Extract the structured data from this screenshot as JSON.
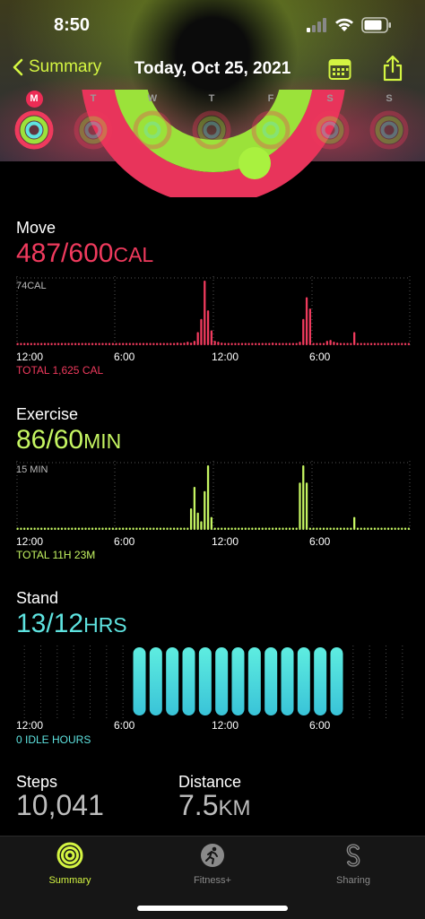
{
  "status": {
    "time": "8:50"
  },
  "nav": {
    "back_label": "Summary",
    "title": "Today, Oct 25, 2021"
  },
  "week": [
    {
      "letter": "M",
      "today": true
    },
    {
      "letter": "T",
      "today": false
    },
    {
      "letter": "W",
      "today": false
    },
    {
      "letter": "T",
      "today": false
    },
    {
      "letter": "F",
      "today": false
    },
    {
      "letter": "S",
      "today": false
    },
    {
      "letter": "S",
      "today": false
    }
  ],
  "colors": {
    "move": "#ef3a5d",
    "exercise": "#c5f562",
    "stand": "#5ee3e0",
    "accent": "#d4f542"
  },
  "move": {
    "label": "Move",
    "value": "487/600",
    "unit": "CAL",
    "max_label": "74CAL",
    "total": "TOTAL 1,625 CAL",
    "axis": [
      "12:00",
      "6:00",
      "12:00",
      "6:00"
    ]
  },
  "exercise": {
    "label": "Exercise",
    "value": "86/60",
    "unit": "MIN",
    "max_label": "15 MIN",
    "total": "TOTAL 11H 23M",
    "axis": [
      "12:00",
      "6:00",
      "12:00",
      "6:00"
    ]
  },
  "stand": {
    "label": "Stand",
    "value": "13/12",
    "unit": "HRS",
    "total": "0 IDLE HOURS",
    "axis": [
      "12:00",
      "6:00",
      "12:00",
      "6:00"
    ]
  },
  "steps": {
    "label": "Steps",
    "value": "10,041"
  },
  "distance": {
    "label": "Distance",
    "value": "7.5",
    "unit": "KM"
  },
  "tabs": [
    {
      "label": "Summary",
      "icon": "activity-rings-icon",
      "active": true
    },
    {
      "label": "Fitness+",
      "icon": "running-figure-icon",
      "active": false
    },
    {
      "label": "Sharing",
      "icon": "sharing-icon",
      "active": false
    }
  ],
  "chart_data": [
    {
      "type": "bar",
      "title": "Move",
      "ylabel": "74CAL",
      "x": [
        "12:00",
        "6:00",
        "12:00",
        "6:00"
      ],
      "values": [
        1,
        1,
        1,
        1,
        1,
        1,
        1,
        1,
        1,
        1,
        1,
        1,
        1,
        1,
        1,
        1,
        1,
        1,
        1,
        1,
        1,
        1,
        1,
        1,
        1,
        1,
        1,
        1,
        1,
        1,
        1,
        1,
        1,
        1,
        1,
        1,
        1,
        1,
        1,
        1,
        1,
        1,
        1,
        2,
        1,
        1,
        2,
        3,
        2,
        3,
        4,
        3,
        5,
        15,
        30,
        74,
        40,
        17,
        5,
        4,
        3,
        2,
        2,
        2,
        2,
        1,
        1,
        1,
        1,
        1,
        1,
        1,
        1,
        2,
        2,
        3,
        2,
        1,
        1,
        1,
        1,
        2,
        2,
        4,
        30,
        55,
        42,
        2,
        1,
        1,
        2,
        5,
        6,
        4,
        3,
        2,
        2,
        2,
        2,
        15,
        2,
        1,
        1,
        1,
        1,
        1,
        1,
        1,
        1,
        1,
        1,
        1,
        1,
        1,
        1,
        1
      ],
      "ylim": [
        0,
        74
      ]
    },
    {
      "type": "bar",
      "title": "Exercise",
      "ylabel": "15 MIN",
      "x": [
        "12:00",
        "6:00",
        "12:00",
        "6:00"
      ],
      "values": [
        0,
        0,
        0,
        0,
        0,
        0,
        0,
        0,
        0,
        0,
        0,
        0,
        0,
        0,
        0,
        0,
        0,
        0,
        0,
        0,
        0,
        0,
        0,
        0,
        0,
        0,
        0,
        0,
        0,
        0,
        0,
        0,
        0,
        0,
        0,
        0,
        0,
        0,
        0,
        0,
        0,
        0,
        0,
        0,
        0,
        0,
        0,
        0,
        0,
        0,
        0,
        5,
        10,
        4,
        2,
        9,
        15,
        3,
        0,
        0,
        0,
        0,
        0,
        0,
        0,
        0,
        0,
        0,
        0,
        0,
        0,
        0,
        0,
        0,
        0,
        0,
        0,
        0,
        0,
        0,
        0,
        0,
        0,
        11,
        15,
        11,
        0,
        0,
        0,
        0,
        0,
        0,
        0,
        0,
        0,
        0,
        0,
        0,
        0,
        3,
        0,
        0,
        0,
        0,
        0,
        0,
        0,
        0,
        0,
        0,
        0,
        0,
        0,
        0,
        0,
        0
      ],
      "ylim": [
        0,
        15
      ]
    },
    {
      "type": "bar",
      "title": "Stand",
      "x": [
        "12:00",
        "6:00",
        "12:00",
        "6:00"
      ],
      "values": [
        0,
        0,
        0,
        0,
        0,
        0,
        0,
        1,
        1,
        1,
        1,
        1,
        1,
        1,
        1,
        1,
        1,
        1,
        1,
        1,
        0,
        0,
        0,
        0
      ],
      "ylim": [
        0,
        1
      ]
    }
  ]
}
